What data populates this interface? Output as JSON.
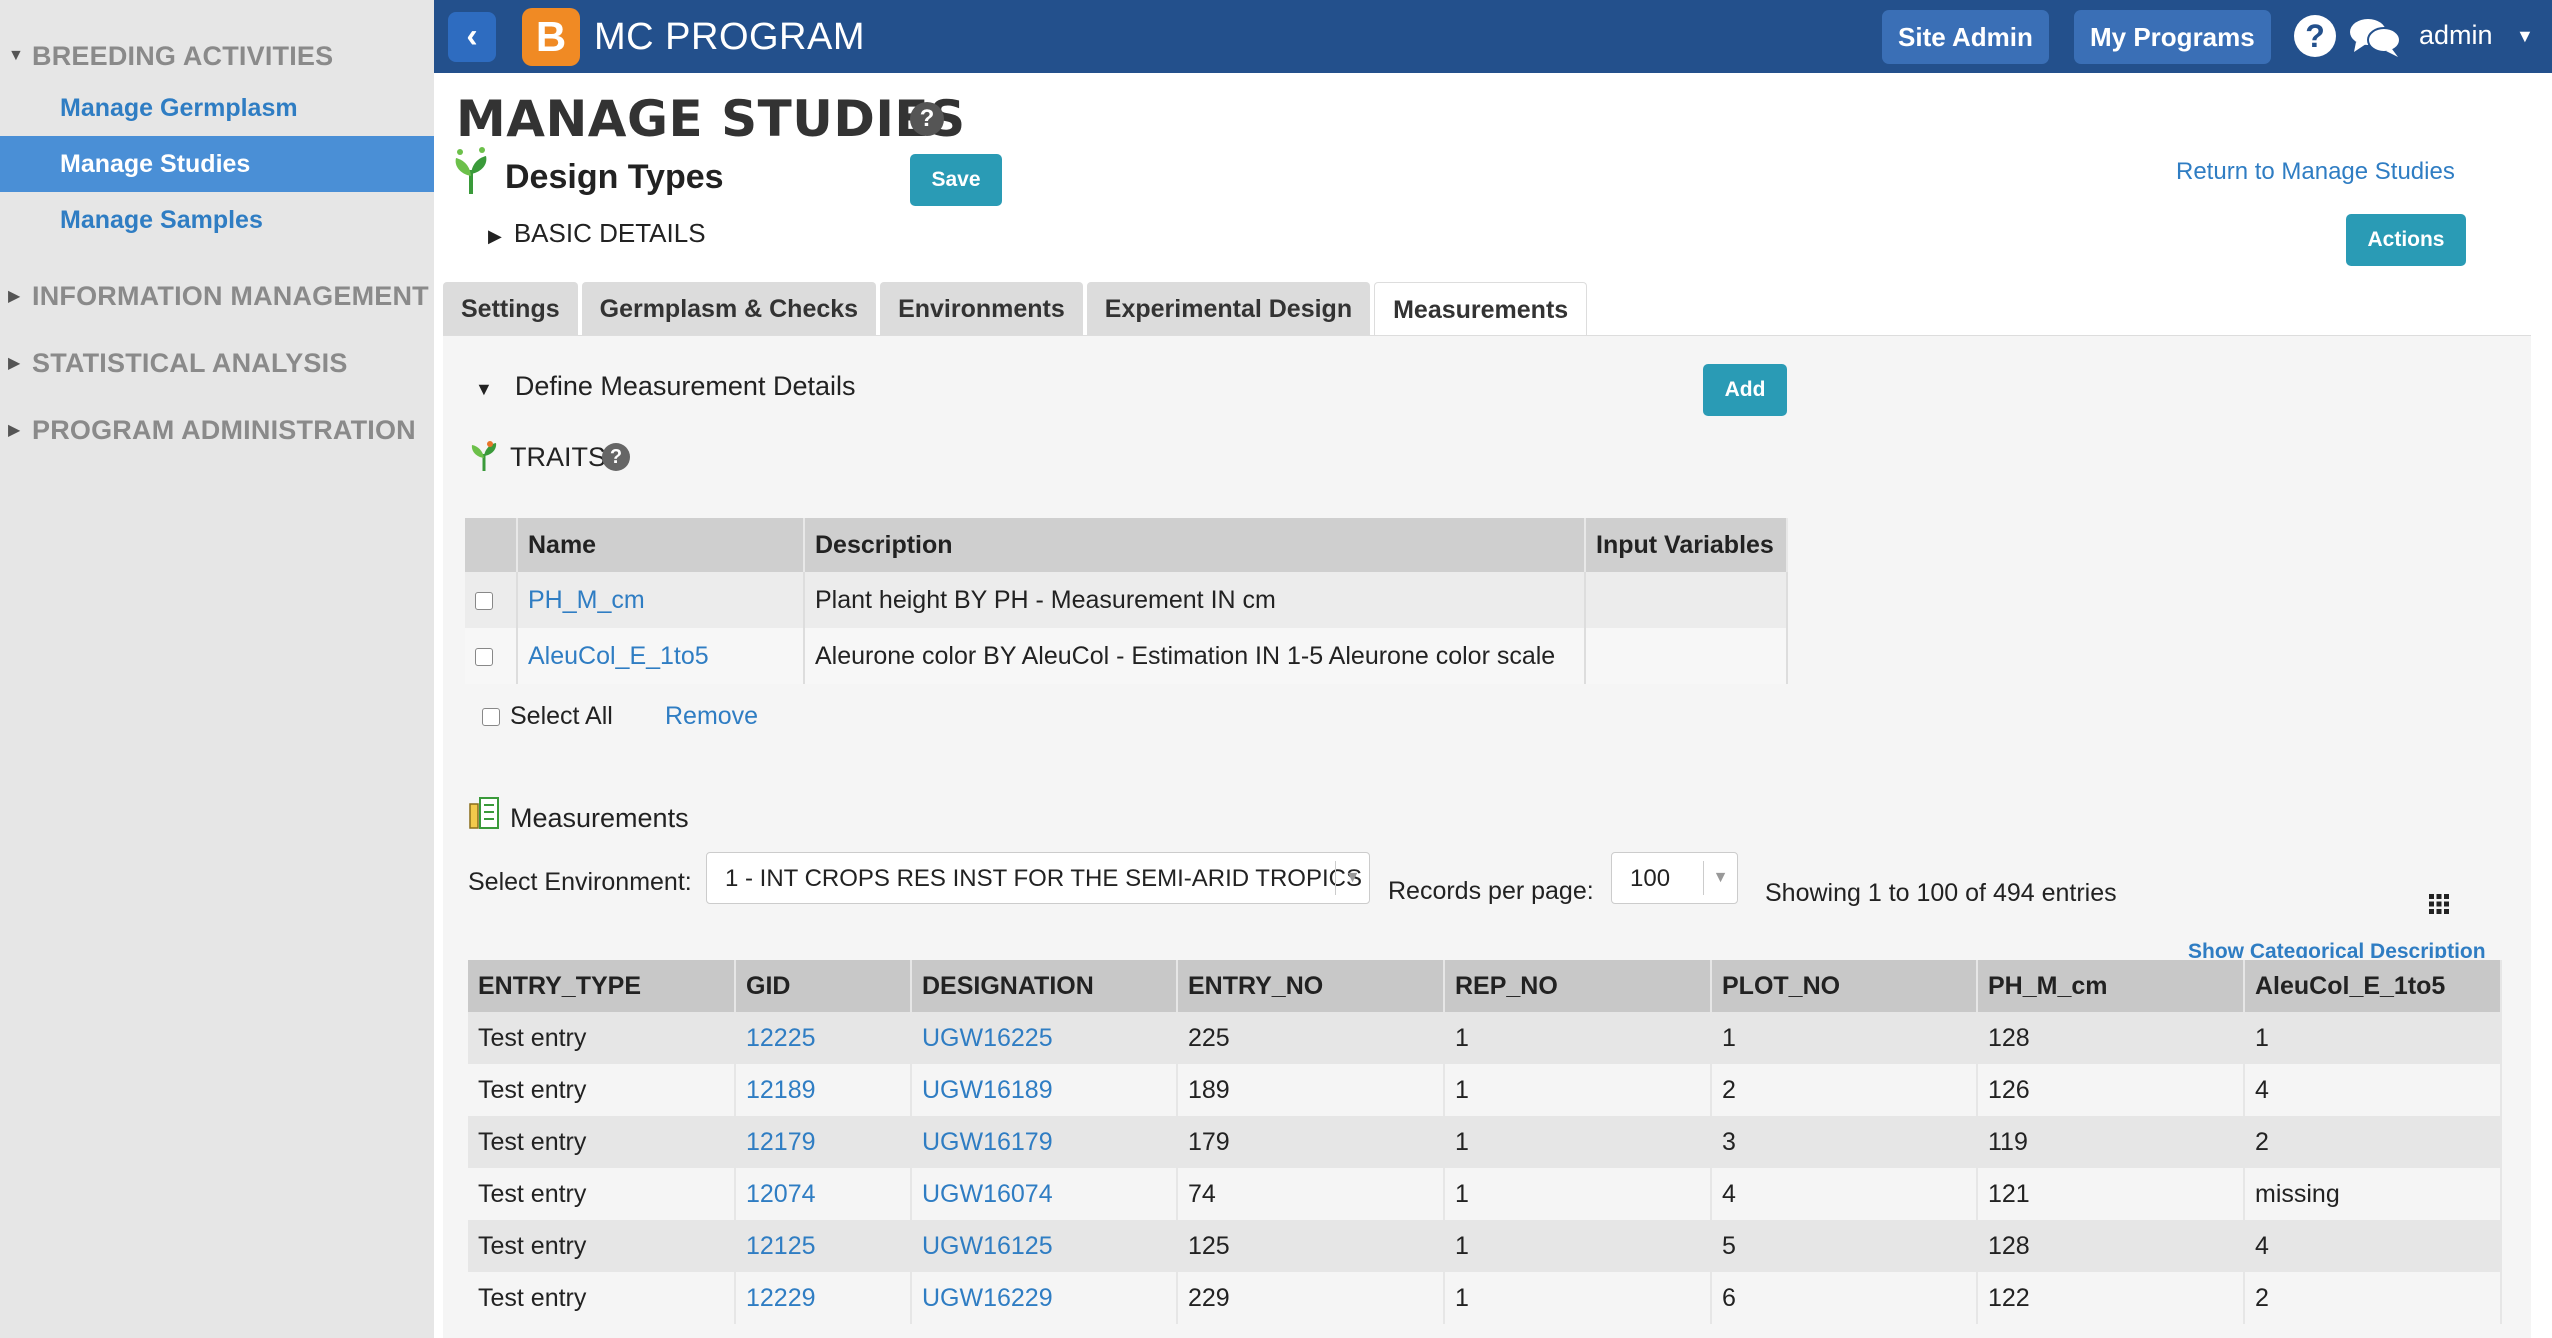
{
  "sidebar": {
    "sections": [
      {
        "label": "BREEDING ACTIVITIES",
        "expanded": true
      },
      {
        "label": "INFORMATION MANAGEMENT",
        "expanded": false
      },
      {
        "label": "STATISTICAL ANALYSIS",
        "expanded": false
      },
      {
        "label": "PROGRAM ADMINISTRATION",
        "expanded": false
      }
    ],
    "links": [
      {
        "label": "Manage Germplasm",
        "active": false
      },
      {
        "label": "Manage Studies",
        "active": true
      },
      {
        "label": "Manage Samples",
        "active": false
      }
    ]
  },
  "topbar": {
    "logo_letter": "B",
    "app_title": "MC PROGRAM",
    "site_admin": "Site Admin",
    "my_programs": "My Programs",
    "help_glyph": "?",
    "user": "admin"
  },
  "page": {
    "title": "MANAGE STUDIES",
    "study_name": "Design Types",
    "save_label": "Save",
    "return_link": "Return to Manage Studies",
    "actions_label": "Actions",
    "basic_details": "BASIC DETAILS"
  },
  "tabs": [
    {
      "label": "Settings",
      "active": false
    },
    {
      "label": "Germplasm & Checks",
      "active": false
    },
    {
      "label": "Environments",
      "active": false
    },
    {
      "label": "Experimental Design",
      "active": false
    },
    {
      "label": "Measurements",
      "active": true
    }
  ],
  "measurement_details": {
    "header": "Define Measurement Details",
    "add_label": "Add",
    "traits_label": "TRAITS",
    "traits_table": {
      "columns": [
        "Name",
        "Description",
        "Input Variables"
      ],
      "rows": [
        {
          "name": "PH_M_cm",
          "description": "Plant height BY PH - Measurement IN cm",
          "input_variables": ""
        },
        {
          "name": "AleuCol_E_1to5",
          "description": "Aleurone color BY AleuCol - Estimation IN 1-5 Aleurone color scale",
          "input_variables": ""
        }
      ]
    },
    "select_all": "Select All",
    "remove": "Remove"
  },
  "measurements": {
    "label": "Measurements",
    "env_label": "Select Environment:",
    "env_value": "1 - INT CROPS RES INST FOR THE SEMI-ARID TROPICS",
    "rpp_label": "Records per page:",
    "rpp_value": "100",
    "showing": "Showing 1 to 100 of 494 entries",
    "show_categorical": "Show Categorical Description",
    "columns": [
      "ENTRY_TYPE",
      "GID",
      "DESIGNATION",
      "ENTRY_NO",
      "REP_NO",
      "PLOT_NO",
      "PH_M_cm",
      "AleuCol_E_1to5"
    ],
    "rows": [
      [
        "Test entry",
        "12225",
        "UGW16225",
        "225",
        "1",
        "1",
        "128",
        "1"
      ],
      [
        "Test entry",
        "12189",
        "UGW16189",
        "189",
        "1",
        "2",
        "126",
        "4"
      ],
      [
        "Test entry",
        "12179",
        "UGW16179",
        "179",
        "1",
        "3",
        "119",
        "2"
      ],
      [
        "Test entry",
        "12074",
        "UGW16074",
        "74",
        "1",
        "4",
        "121",
        "missing"
      ],
      [
        "Test entry",
        "12125",
        "UGW16125",
        "125",
        "1",
        "5",
        "128",
        "4"
      ],
      [
        "Test entry",
        "12229",
        "UGW16229",
        "229",
        "1",
        "6",
        "122",
        "2"
      ]
    ]
  }
}
